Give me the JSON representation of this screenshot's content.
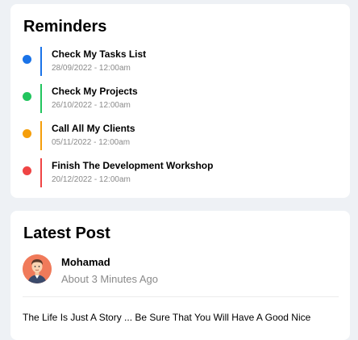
{
  "reminders": {
    "title": "Reminders",
    "items": [
      {
        "title": "Check My Tasks List",
        "date": "28/09/2022 - 12:00am",
        "color": "#1a73e8"
      },
      {
        "title": "Check My Projects",
        "date": "26/10/2022 - 12:00am",
        "color": "#22c55e"
      },
      {
        "title": "Call All My Clients",
        "date": "05/11/2022 - 12:00am",
        "color": "#f59e0b"
      },
      {
        "title": "Finish The Development Workshop",
        "date": "20/12/2022 - 12:00am",
        "color": "#ef4444"
      }
    ]
  },
  "latest_post": {
    "title": "Latest Post",
    "author": "Mohamad",
    "time": "About 3 Minutes Ago",
    "text": "The Life Is Just A Story ... Be Sure That You Will Have A Good Nice",
    "avatar_icon": "user-avatar"
  }
}
